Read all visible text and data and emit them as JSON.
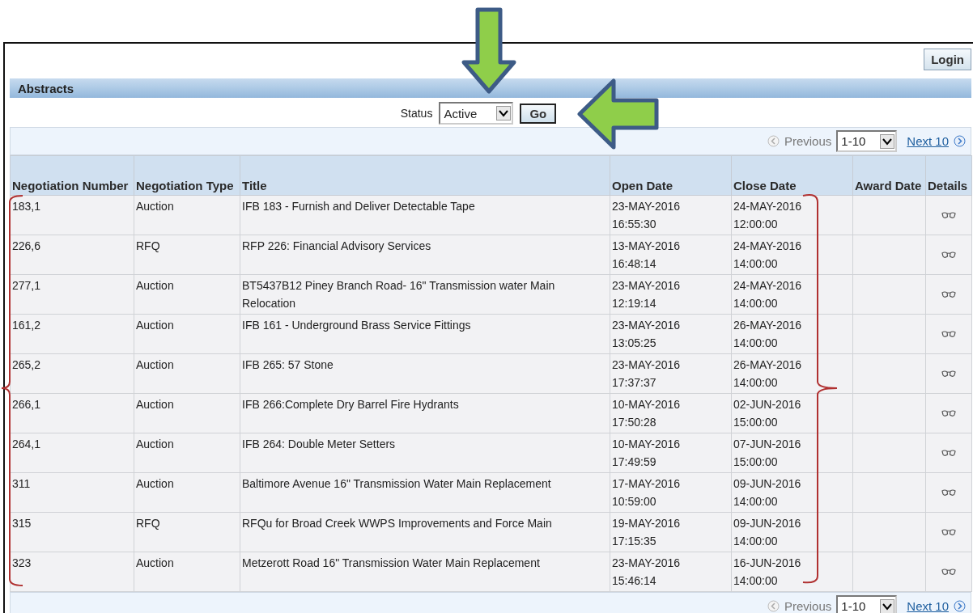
{
  "login_button": "Login",
  "section_title": "Abstracts",
  "status_filter": {
    "label": "Status",
    "value": "Active"
  },
  "go_button": "Go",
  "pagination_top": {
    "previous": "Previous",
    "range": "1-10",
    "next": "Next 10"
  },
  "table": {
    "columns": [
      "Negotiation Number",
      "Negotiation Type",
      "Title",
      "Open Date",
      "Close Date",
      "Award Date",
      "Details"
    ],
    "rows": [
      {
        "number": "183,1",
        "type": "Auction",
        "title": "IFB 183 - Furnish and Deliver Detectable Tape",
        "open": [
          "23-MAY-2016",
          "16:55:30"
        ],
        "close": [
          "24-MAY-2016",
          "12:00:00"
        ]
      },
      {
        "number": "226,6",
        "type": "RFQ",
        "title": "RFP 226: Financial Advisory Services",
        "open": [
          "13-MAY-2016",
          "16:48:14"
        ],
        "close": [
          "24-MAY-2016",
          "14:00:00"
        ]
      },
      {
        "number": "277,1",
        "type": "Auction",
        "title": "BT5437B12 Piney Branch Road- 16\" Transmission water Main Relocation",
        "open": [
          "23-MAY-2016",
          "12:19:14"
        ],
        "close": [
          "24-MAY-2016",
          "14:00:00"
        ]
      },
      {
        "number": "161,2",
        "type": "Auction",
        "title": "IFB 161 - Underground Brass Service Fittings",
        "open": [
          "23-MAY-2016",
          "13:05:25"
        ],
        "close": [
          "26-MAY-2016",
          "14:00:00"
        ]
      },
      {
        "number": "265,2",
        "type": "Auction",
        "title": "IFB 265: 57 Stone",
        "open": [
          "23-MAY-2016",
          "17:37:37"
        ],
        "close": [
          "26-MAY-2016",
          "14:00:00"
        ]
      },
      {
        "number": "266,1",
        "type": "Auction",
        "title": "IFB 266:Complete Dry Barrel Fire Hydrants",
        "open": [
          "10-MAY-2016",
          "17:50:28"
        ],
        "close": [
          "02-JUN-2016",
          "15:00:00"
        ]
      },
      {
        "number": "264,1",
        "type": "Auction",
        "title": "IFB 264: Double Meter Setters",
        "open": [
          "10-MAY-2016",
          "17:49:59"
        ],
        "close": [
          "07-JUN-2016",
          "15:00:00"
        ]
      },
      {
        "number": "311",
        "type": "Auction",
        "title": "Baltimore Avenue 16\" Transmission Water Main Replacement",
        "open": [
          "17-MAY-2016",
          "10:59:00"
        ],
        "close": [
          "09-JUN-2016",
          "14:00:00"
        ]
      },
      {
        "number": "315",
        "type": "RFQ",
        "title": "RFQu for Broad Creek WWPS Improvements and Force Main",
        "open": [
          "19-MAY-2016",
          "17:15:35"
        ],
        "close": [
          "09-JUN-2016",
          "14:00:00"
        ]
      },
      {
        "number": "323",
        "type": "Auction",
        "title": "Metzerott Road 16\" Transmission Water Main Replacement",
        "open": [
          "23-MAY-2016",
          "15:46:14"
        ],
        "close": [
          "16-JUN-2016",
          "14:00:00"
        ]
      }
    ]
  },
  "pagination_bottom": {
    "previous": "Previous",
    "range": "1-10",
    "next": "Next 10"
  }
}
